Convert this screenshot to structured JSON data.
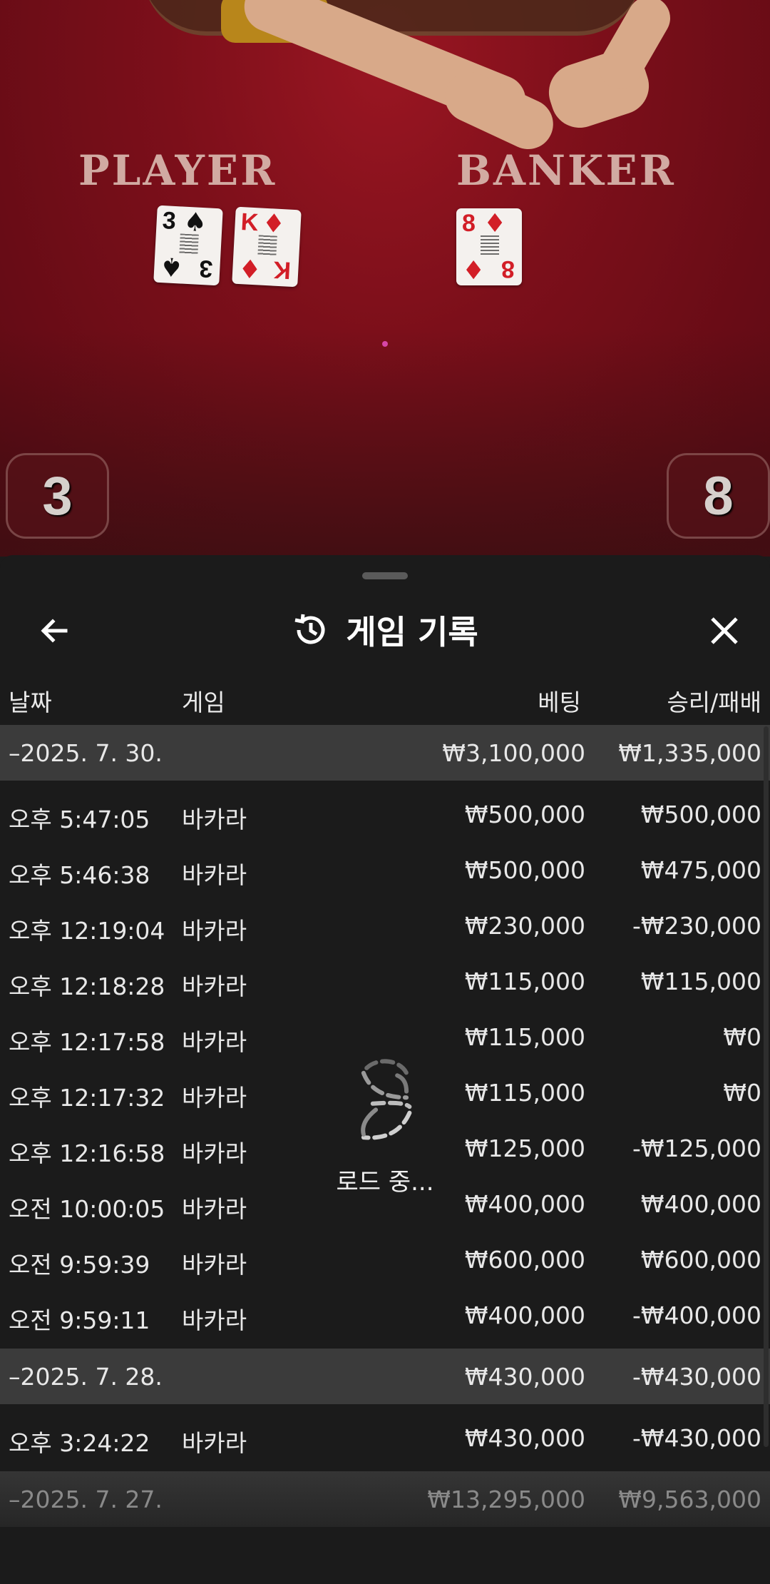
{
  "table": {
    "player_label": "PLAYER",
    "banker_label": "BANKER",
    "player_cards": [
      {
        "rank": "3",
        "suit": "♠",
        "color": "black"
      },
      {
        "rank": "K",
        "suit": "♦",
        "color": "red"
      }
    ],
    "banker_cards": [
      {
        "rank": "8",
        "suit": "♦",
        "color": "red"
      }
    ],
    "player_score": "3",
    "banker_score": "8"
  },
  "sheet": {
    "title": "게임 기록",
    "back_icon": "arrow-left-icon",
    "history_icon": "history-icon",
    "close_icon": "close-icon",
    "columns": {
      "date": "날짜",
      "game": "게임",
      "bet": "베팅",
      "result": "승리/패배"
    },
    "loading_text": "로드 중...",
    "groups": [
      {
        "date": "–2025. 7. 30.",
        "bet": "₩3,100,000",
        "result": "₩1,335,000",
        "items": [
          {
            "time": "오후 5:47:05",
            "game": "바카라",
            "bet": "₩500,000",
            "result": "₩500,000"
          },
          {
            "time": "오후 5:46:38",
            "game": "바카라",
            "bet": "₩500,000",
            "result": "₩475,000"
          },
          {
            "time": "오후 12:19:04",
            "game": "바카라",
            "bet": "₩230,000",
            "result": "-₩230,000"
          },
          {
            "time": "오후 12:18:28",
            "game": "바카라",
            "bet": "₩115,000",
            "result": "₩115,000"
          },
          {
            "time": "오후 12:17:58",
            "game": "바카라",
            "bet": "₩115,000",
            "result": "₩0"
          },
          {
            "time": "오후 12:17:32",
            "game": "바카라",
            "bet": "₩115,000",
            "result": "₩0"
          },
          {
            "time": "오후 12:16:58",
            "game": "바카라",
            "bet": "₩125,000",
            "result": "-₩125,000"
          },
          {
            "time": "오전 10:00:05",
            "game": "바카라",
            "bet": "₩400,000",
            "result": "₩400,000"
          },
          {
            "time": "오전 9:59:39",
            "game": "바카라",
            "bet": "₩600,000",
            "result": "₩600,000"
          },
          {
            "time": "오전 9:59:11",
            "game": "바카라",
            "bet": "₩400,000",
            "result": "-₩400,000"
          }
        ]
      },
      {
        "date": "–2025. 7. 28.",
        "bet": "₩430,000",
        "result": "-₩430,000",
        "items": [
          {
            "time": "오후 3:24:22",
            "game": "바카라",
            "bet": "₩430,000",
            "result": "-₩430,000"
          }
        ]
      },
      {
        "date": "–2025. 7. 27.",
        "bet": "₩13,295,000",
        "result": "₩9,563,000",
        "items": []
      }
    ]
  }
}
